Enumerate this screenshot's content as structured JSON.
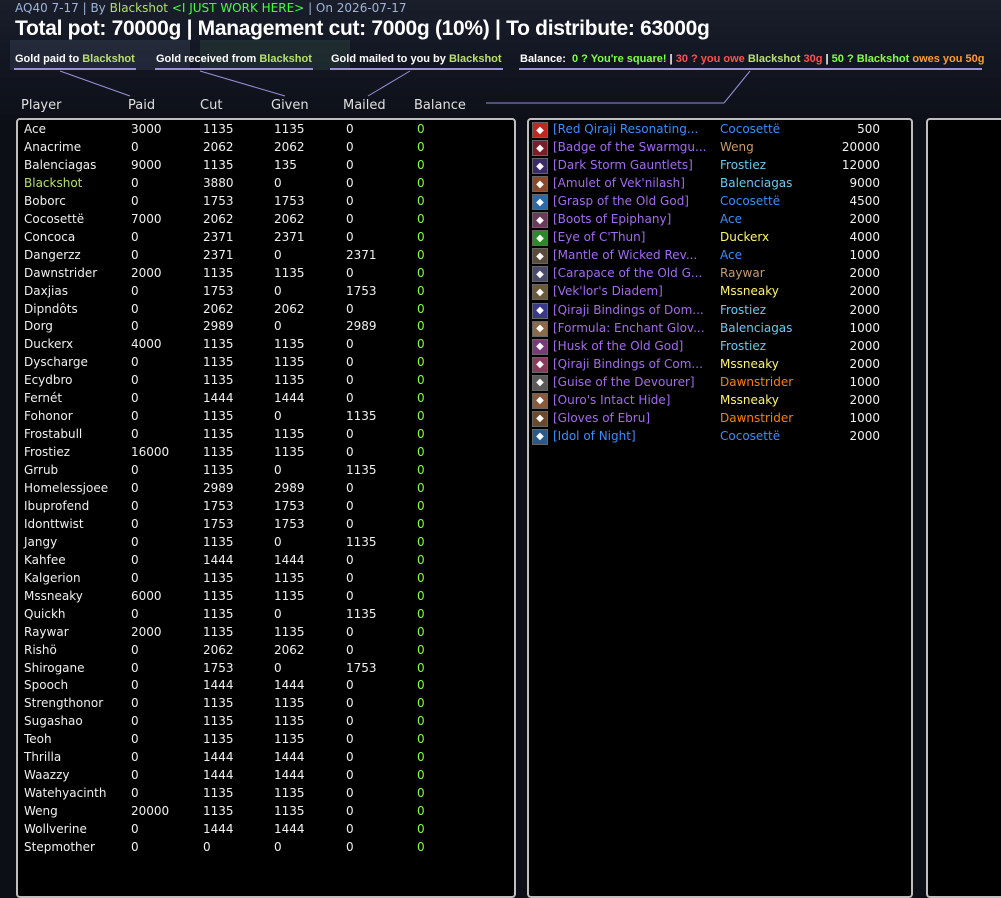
{
  "header": {
    "raid": "AQ40 7-17",
    "by_label": "By",
    "author": "Blackshot",
    "guild": "<I JUST WORK HERE>",
    "date": "On 2026-07-17",
    "totals": "Total pot: 70000g | Management cut: 7000g (10%) | To distribute: 63000g"
  },
  "legend": {
    "paid_prefix": "Gold paid to",
    "received_prefix": "Gold received from",
    "mailed_prefix": "Gold mailed to you by",
    "name": "Blackshot",
    "balance_label": "Balance:",
    "square": "0 ? You're square!",
    "owe_prefix": "30 ? you owe",
    "owe_amount": "30g",
    "owes_prefix": "50 ? Blackshot",
    "owes_suffix": "owes you 50g"
  },
  "columns": [
    "Player",
    "Paid",
    "Cut",
    "Given",
    "Mailed",
    "Balance"
  ],
  "players": [
    {
      "name": "Ace",
      "paid": "3000",
      "cut": "1135",
      "given": "1135",
      "mailed": "0",
      "balance": "0"
    },
    {
      "name": "Anacrime",
      "paid": "0",
      "cut": "2062",
      "given": "2062",
      "mailed": "0",
      "balance": "0"
    },
    {
      "name": "Balenciagas",
      "paid": "9000",
      "cut": "1135",
      "given": "135",
      "mailed": "0",
      "balance": "0"
    },
    {
      "name": "Blackshot",
      "paid": "0",
      "cut": "3880",
      "given": "0",
      "mailed": "0",
      "balance": "0",
      "highlight": true
    },
    {
      "name": "Boborc",
      "paid": "0",
      "cut": "1753",
      "given": "1753",
      "mailed": "0",
      "balance": "0"
    },
    {
      "name": "Cocosettë",
      "paid": "7000",
      "cut": "2062",
      "given": "2062",
      "mailed": "0",
      "balance": "0"
    },
    {
      "name": "Concoca",
      "paid": "0",
      "cut": "2371",
      "given": "2371",
      "mailed": "0",
      "balance": "0"
    },
    {
      "name": "Dangerzz",
      "paid": "0",
      "cut": "2371",
      "given": "0",
      "mailed": "2371",
      "balance": "0"
    },
    {
      "name": "Dawnstrider",
      "paid": "2000",
      "cut": "1135",
      "given": "1135",
      "mailed": "0",
      "balance": "0"
    },
    {
      "name": "Daxjias",
      "paid": "0",
      "cut": "1753",
      "given": "0",
      "mailed": "1753",
      "balance": "0"
    },
    {
      "name": "Dipndôts",
      "paid": "0",
      "cut": "2062",
      "given": "2062",
      "mailed": "0",
      "balance": "0"
    },
    {
      "name": "Dorg",
      "paid": "0",
      "cut": "2989",
      "given": "0",
      "mailed": "2989",
      "balance": "0"
    },
    {
      "name": "Duckerx",
      "paid": "4000",
      "cut": "1135",
      "given": "1135",
      "mailed": "0",
      "balance": "0"
    },
    {
      "name": "Dyscharge",
      "paid": "0",
      "cut": "1135",
      "given": "1135",
      "mailed": "0",
      "balance": "0"
    },
    {
      "name": "Ecydbro",
      "paid": "0",
      "cut": "1135",
      "given": "1135",
      "mailed": "0",
      "balance": "0"
    },
    {
      "name": "Fernét",
      "paid": "0",
      "cut": "1444",
      "given": "1444",
      "mailed": "0",
      "balance": "0"
    },
    {
      "name": "Fohonor",
      "paid": "0",
      "cut": "1135",
      "given": "0",
      "mailed": "1135",
      "balance": "0"
    },
    {
      "name": "Frostabull",
      "paid": "0",
      "cut": "1135",
      "given": "1135",
      "mailed": "0",
      "balance": "0"
    },
    {
      "name": "Frostiez",
      "paid": "16000",
      "cut": "1135",
      "given": "1135",
      "mailed": "0",
      "balance": "0"
    },
    {
      "name": "Grrub",
      "paid": "0",
      "cut": "1135",
      "given": "0",
      "mailed": "1135",
      "balance": "0"
    },
    {
      "name": "Homelessjoee",
      "paid": "0",
      "cut": "2989",
      "given": "2989",
      "mailed": "0",
      "balance": "0"
    },
    {
      "name": "Ibuprofend",
      "paid": "0",
      "cut": "1753",
      "given": "1753",
      "mailed": "0",
      "balance": "0"
    },
    {
      "name": "Idonttwist",
      "paid": "0",
      "cut": "1753",
      "given": "1753",
      "mailed": "0",
      "balance": "0"
    },
    {
      "name": "Jangy",
      "paid": "0",
      "cut": "1135",
      "given": "0",
      "mailed": "1135",
      "balance": "0"
    },
    {
      "name": "Kahfee",
      "paid": "0",
      "cut": "1444",
      "given": "1444",
      "mailed": "0",
      "balance": "0"
    },
    {
      "name": "Kalgerion",
      "paid": "0",
      "cut": "1135",
      "given": "1135",
      "mailed": "0",
      "balance": "0"
    },
    {
      "name": "Mssneaky",
      "paid": "6000",
      "cut": "1135",
      "given": "1135",
      "mailed": "0",
      "balance": "0"
    },
    {
      "name": "Quickh",
      "paid": "0",
      "cut": "1135",
      "given": "0",
      "mailed": "1135",
      "balance": "0"
    },
    {
      "name": "Raywar",
      "paid": "2000",
      "cut": "1135",
      "given": "1135",
      "mailed": "0",
      "balance": "0"
    },
    {
      "name": "Rishö",
      "paid": "0",
      "cut": "2062",
      "given": "2062",
      "mailed": "0",
      "balance": "0"
    },
    {
      "name": "Shirogane",
      "paid": "0",
      "cut": "1753",
      "given": "0",
      "mailed": "1753",
      "balance": "0"
    },
    {
      "name": "Spooch",
      "paid": "0",
      "cut": "1444",
      "given": "1444",
      "mailed": "0",
      "balance": "0"
    },
    {
      "name": "Strengthonor",
      "paid": "0",
      "cut": "1135",
      "given": "1135",
      "mailed": "0",
      "balance": "0"
    },
    {
      "name": "Sugashao",
      "paid": "0",
      "cut": "1135",
      "given": "1135",
      "mailed": "0",
      "balance": "0"
    },
    {
      "name": "Teoh",
      "paid": "0",
      "cut": "1135",
      "given": "1135",
      "mailed": "0",
      "balance": "0"
    },
    {
      "name": "Thrilla",
      "paid": "0",
      "cut": "1444",
      "given": "1444",
      "mailed": "0",
      "balance": "0"
    },
    {
      "name": "Waazzy",
      "paid": "0",
      "cut": "1444",
      "given": "1444",
      "mailed": "0",
      "balance": "0"
    },
    {
      "name": "Watehyacinth",
      "paid": "0",
      "cut": "1135",
      "given": "1135",
      "mailed": "0",
      "balance": "0"
    },
    {
      "name": "Weng",
      "paid": "20000",
      "cut": "1135",
      "given": "1135",
      "mailed": "0",
      "balance": "0"
    },
    {
      "name": "Wollverine",
      "paid": "0",
      "cut": "1444",
      "given": "1444",
      "mailed": "0",
      "balance": "0"
    },
    {
      "name": "Stepmother",
      "paid": "0",
      "cut": "0",
      "given": "0",
      "mailed": "0",
      "balance": "0"
    }
  ],
  "colors": {
    "balance_zero": "#80ff40",
    "highlight_name": "#b8e06a",
    "panel_border": "#bfbfbf",
    "epic": "#a46af0",
    "rare": "#3a8eff"
  },
  "loot": [
    {
      "item": "[Red Qiraji Resonating...",
      "winner": "Cocosettë",
      "price": "500",
      "quality": "rare",
      "icon": "red-crystal-icon",
      "icon_color": "#c0281e",
      "winner_color": "#3a8eff"
    },
    {
      "item": "[Badge of the Swarmgu...",
      "winner": "Weng",
      "price": "20000",
      "quality": "epic",
      "icon": "badge-icon",
      "icon_color": "#7a1f2a",
      "winner_color": "#c79c6e"
    },
    {
      "item": "[Dark Storm Gauntlets]",
      "winner": "Frostiez",
      "price": "12000",
      "quality": "epic",
      "icon": "gauntlets-icon",
      "icon_color": "#3a2a66",
      "winner_color": "#6cc8f0"
    },
    {
      "item": "[Amulet of Vek'nilash]",
      "winner": "Balenciagas",
      "price": "9000",
      "quality": "epic",
      "icon": "amulet-icon",
      "icon_color": "#8a4a2a",
      "winner_color": "#6cc8f0"
    },
    {
      "item": "[Grasp of the Old God]",
      "winner": "Cocosettë",
      "price": "4500",
      "quality": "epic",
      "icon": "grasp-icon",
      "icon_color": "#2a6aa8",
      "winner_color": "#3a8eff"
    },
    {
      "item": "[Boots of Epiphany]",
      "winner": "Ace",
      "price": "2000",
      "quality": "epic",
      "icon": "boots-icon",
      "icon_color": "#6a3a5a",
      "winner_color": "#3a8eff"
    },
    {
      "item": "[Eye of C'Thun]",
      "winner": "Duckerx",
      "price": "4000",
      "quality": "epic",
      "icon": "eye-icon",
      "icon_color": "#2a8a2a",
      "winner_color": "#fff569"
    },
    {
      "item": "[Mantle of Wicked Rev...",
      "winner": "Ace",
      "price": "1000",
      "quality": "epic",
      "icon": "mantle-icon",
      "icon_color": "#5a4a3a",
      "winner_color": "#3a8eff"
    },
    {
      "item": "[Carapace of the Old G...",
      "winner": "Raywar",
      "price": "2000",
      "quality": "epic",
      "icon": "carapace-icon",
      "icon_color": "#4a4a6a",
      "winner_color": "#c79c6e"
    },
    {
      "item": "[Vek'lor's Diadem]",
      "winner": "Mssneaky",
      "price": "2000",
      "quality": "epic",
      "icon": "diadem-icon",
      "icon_color": "#6a5a3a",
      "winner_color": "#fff569"
    },
    {
      "item": "[Qiraji Bindings of Dom...",
      "winner": "Frostiez",
      "price": "2000",
      "quality": "epic",
      "icon": "bindings-icon",
      "icon_color": "#3a3a8a",
      "winner_color": "#6cc8f0"
    },
    {
      "item": "[Formula: Enchant Glov...",
      "winner": "Balenciagas",
      "price": "1000",
      "quality": "epic",
      "icon": "formula-icon",
      "icon_color": "#8a6a4a",
      "winner_color": "#6cc8f0"
    },
    {
      "item": "[Husk of the Old God]",
      "winner": "Frostiez",
      "price": "2000",
      "quality": "epic",
      "icon": "husk-icon",
      "icon_color": "#7a3a7a",
      "winner_color": "#6cc8f0"
    },
    {
      "item": "[Qiraji Bindings of Com...",
      "winner": "Mssneaky",
      "price": "2000",
      "quality": "epic",
      "icon": "bindings-icon",
      "icon_color": "#8a3a5a",
      "winner_color": "#fff569"
    },
    {
      "item": "[Guise of the Devourer]",
      "winner": "Dawnstrider",
      "price": "1000",
      "quality": "epic",
      "icon": "guise-icon",
      "icon_color": "#5a5a5a",
      "winner_color": "#ff7d0a"
    },
    {
      "item": "[Ouro's Intact Hide]",
      "winner": "Mssneaky",
      "price": "2000",
      "quality": "epic",
      "icon": "hide-icon",
      "icon_color": "#8a5a3a",
      "winner_color": "#fff569"
    },
    {
      "item": "[Gloves of Ebru]",
      "winner": "Dawnstrider",
      "price": "1000",
      "quality": "epic",
      "icon": "gloves-icon",
      "icon_color": "#6a4a2a",
      "winner_color": "#ff7d0a"
    },
    {
      "item": "[Idol of Night]",
      "winner": "Cocosettë",
      "price": "2000",
      "quality": "rare",
      "icon": "idol-icon",
      "icon_color": "#2a5a8a",
      "winner_color": "#3a8eff"
    }
  ]
}
